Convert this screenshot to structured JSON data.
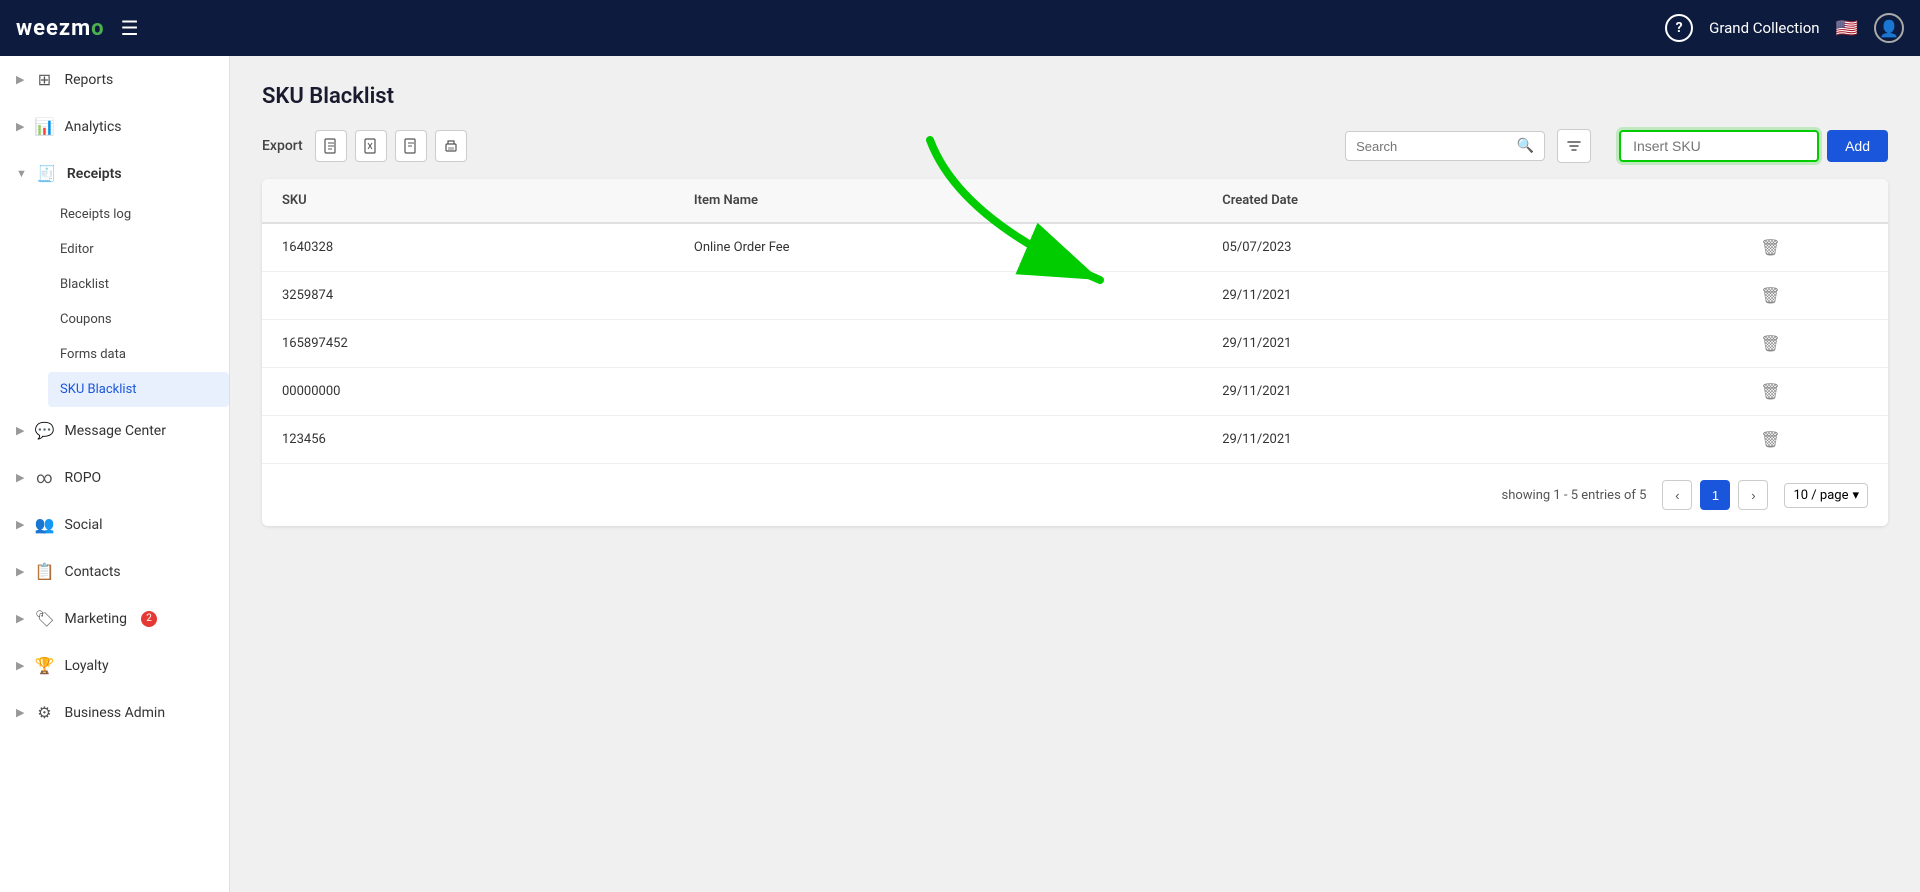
{
  "app": {
    "name": "weezm",
    "logo_accent": "o"
  },
  "header": {
    "menu_icon": "☰",
    "help_label": "?",
    "collection": "Grand Collection",
    "flag": "🇺🇸",
    "avatar_icon": "👤"
  },
  "sidebar": {
    "items": [
      {
        "id": "reports",
        "label": "Reports",
        "icon": "⊞",
        "arrow": "▶",
        "expanded": false
      },
      {
        "id": "analytics",
        "label": "Analytics",
        "icon": "📊",
        "arrow": "▶",
        "expanded": false
      },
      {
        "id": "receipts",
        "label": "Receipts",
        "icon": "🧾",
        "arrow": "▼",
        "expanded": true
      },
      {
        "id": "message-center",
        "label": "Message Center",
        "icon": "💬",
        "arrow": "▶",
        "expanded": false
      },
      {
        "id": "ropo",
        "label": "ROPO",
        "icon": "∞",
        "arrow": "▶",
        "expanded": false
      },
      {
        "id": "social",
        "label": "Social",
        "icon": "👥",
        "arrow": "▶",
        "expanded": false
      },
      {
        "id": "contacts",
        "label": "Contacts",
        "icon": "📋",
        "arrow": "▶",
        "expanded": false
      },
      {
        "id": "marketing",
        "label": "Marketing",
        "icon": "🏷",
        "arrow": "▶",
        "expanded": false,
        "badge": "2"
      },
      {
        "id": "loyalty",
        "label": "Loyalty",
        "icon": "🏆",
        "arrow": "▶",
        "expanded": false
      },
      {
        "id": "business-admin",
        "label": "Business Admin",
        "icon": "⚙",
        "arrow": "▶",
        "expanded": false
      }
    ],
    "receipts_sub": [
      {
        "id": "receipts-log",
        "label": "Receipts log",
        "active": false
      },
      {
        "id": "editor",
        "label": "Editor",
        "active": false
      },
      {
        "id": "blacklist",
        "label": "Blacklist",
        "active": false
      },
      {
        "id": "coupons",
        "label": "Coupons",
        "active": false
      },
      {
        "id": "forms-data",
        "label": "Forms data",
        "active": false
      },
      {
        "id": "sku-blacklist",
        "label": "SKU Blacklist",
        "active": true
      }
    ]
  },
  "page": {
    "title": "SKU Blacklist",
    "export_label": "Export"
  },
  "export_icons": [
    {
      "id": "pdf",
      "icon": "📄",
      "title": "PDF"
    },
    {
      "id": "excel",
      "icon": "📊",
      "title": "Excel"
    },
    {
      "id": "doc",
      "icon": "📝",
      "title": "Doc"
    },
    {
      "id": "print",
      "icon": "🖨",
      "title": "Print"
    }
  ],
  "search": {
    "placeholder": "Search",
    "value": ""
  },
  "insert_sku": {
    "placeholder": "Insert SKU",
    "value": ""
  },
  "add_button": "Add",
  "table": {
    "columns": [
      "SKU",
      "Item Name",
      "Created Date",
      ""
    ],
    "rows": [
      {
        "sku": "1640328",
        "item_name": "Online Order Fee",
        "created_date": "05/07/2023"
      },
      {
        "sku": "3259874",
        "item_name": "",
        "created_date": "29/11/2021"
      },
      {
        "sku": "165897452",
        "item_name": "",
        "created_date": "29/11/2021"
      },
      {
        "sku": "00000000",
        "item_name": "",
        "created_date": "29/11/2021"
      },
      {
        "sku": "123456",
        "item_name": "",
        "created_date": "29/11/2021"
      }
    ]
  },
  "pagination": {
    "showing_text": "showing 1 - 5 entries of 5",
    "current_page": 1,
    "per_page": "10 / page"
  }
}
